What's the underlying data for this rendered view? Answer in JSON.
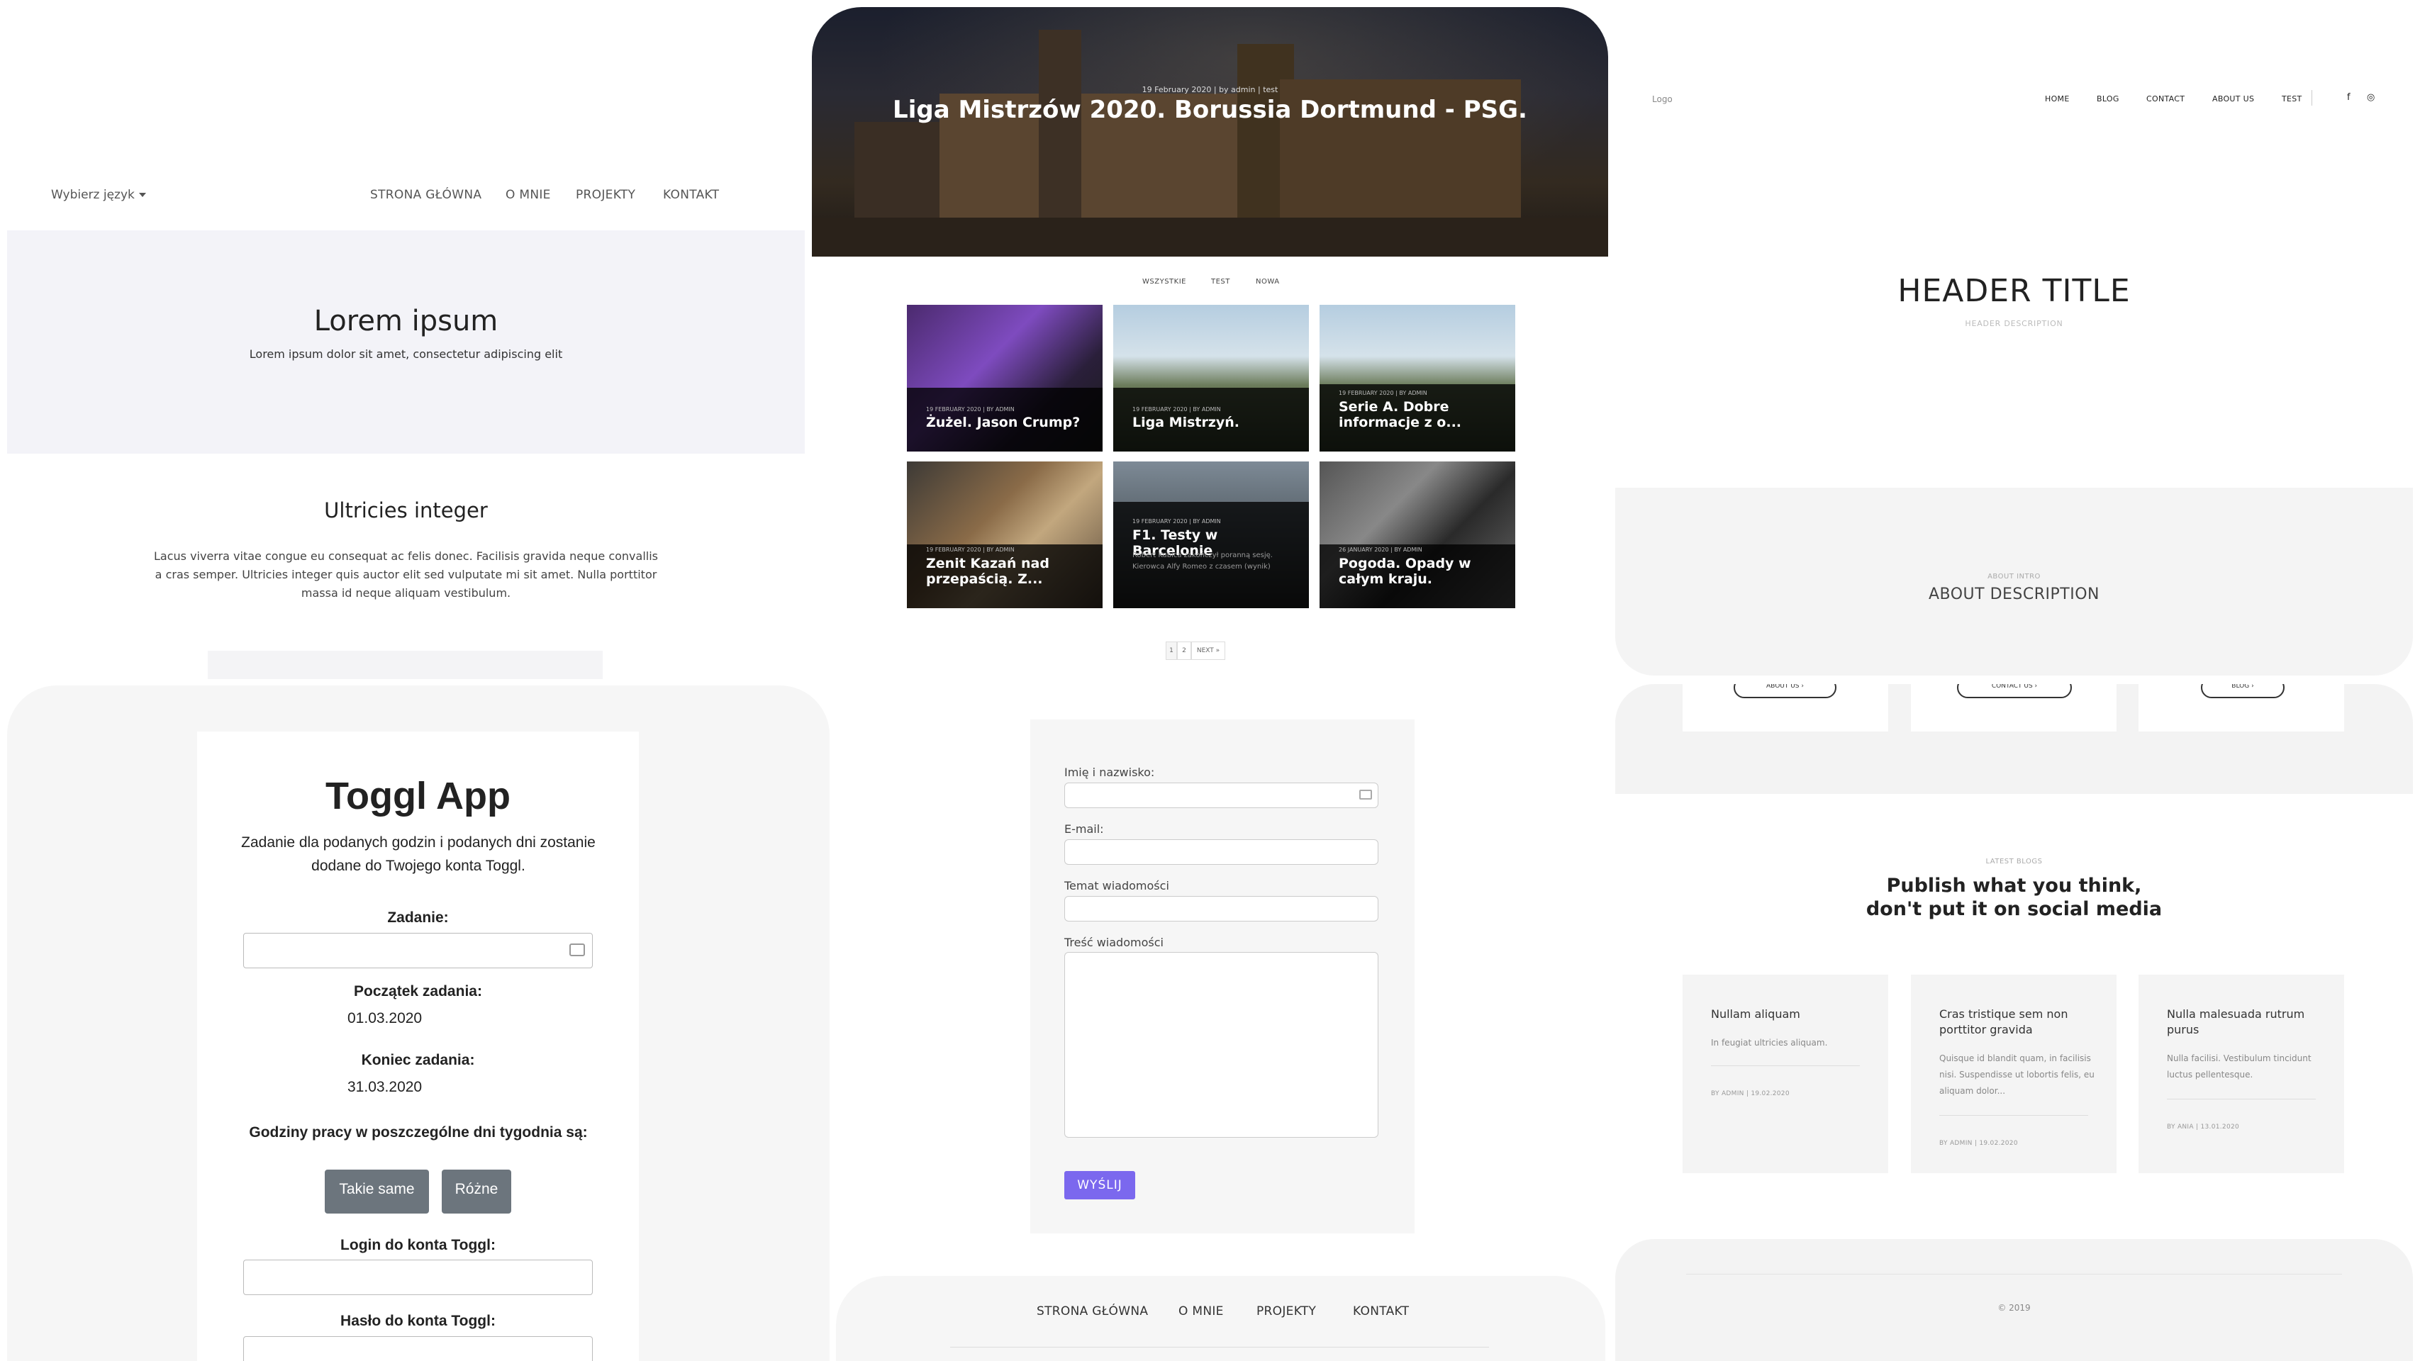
{
  "p1": {
    "language_select": "Wybierz język",
    "nav": [
      "STRONA GŁÓWNA",
      "O MNIE",
      "PROJEKTY",
      "KONTAKT"
    ],
    "hero_title": "Lorem ipsum",
    "hero_subtitle": "Lorem ipsum dolor sit amet, consectetur adipiscing elit",
    "section_title": "Ultricies integer",
    "section_text": "Lacus viverra vitae congue eu consequat ac felis donec. Facilisis gravida neque convallis a cras semper. Ultricies integer quis auctor elit sed vulputate mi sit amet. Nulla porttitor massa id neque aliquam vestibulum."
  },
  "p2": {
    "hero_meta": "19 February 2020 | by admin | test",
    "hero_title": "Liga Mistrzów 2020. Borussia Dortmund - PSG.",
    "filters": [
      "WSZYSTKIE",
      "TEST",
      "NOWA"
    ],
    "cards": [
      {
        "meta": "19 FEBRUARY 2020 | BY ADMIN",
        "title": "Żużel. Jason Crump?",
        "excerpt": ""
      },
      {
        "meta": "19 FEBRUARY 2020 | BY ADMIN",
        "title": "Liga Mistrzyń.",
        "excerpt": ""
      },
      {
        "meta": "19 FEBRUARY 2020 | BY ADMIN",
        "title": "Serie A. Dobre informacje z o...",
        "excerpt": ""
      },
      {
        "meta": "19 FEBRUARY 2020 | BY ADMIN",
        "title": "Zenit Kazań nad przepaścią. Z...",
        "excerpt": ""
      },
      {
        "meta": "19 FEBRUARY 2020 | BY ADMIN",
        "title": "F1. Testy w Barcelonie",
        "excerpt": "Robert Kubica zakończył poranną sesję. Kierowca Alfy Romeo z czasem (wynik)"
      },
      {
        "meta": "26 JANUARY 2020 | BY ADMIN",
        "title": "Pogoda. Opady w całym kraju.",
        "excerpt": ""
      }
    ],
    "pager": [
      "1",
      "2",
      "NEXT »"
    ]
  },
  "p3": {
    "logo": "Logo",
    "nav": [
      "HOME",
      "BLOG",
      "CONTACT",
      "ABOUT US",
      "TEST"
    ],
    "social": [
      "f",
      "◎"
    ],
    "header_title": "HEADER TITLE",
    "header_desc": "HEADER DESCRIPTION",
    "about_intro": "ABOUT INTRO",
    "about_desc": "ABOUT DESCRIPTION"
  },
  "p4": {
    "title": "Toggl App",
    "desc": "Zadanie dla podanych godzin i podanych dni zostanie dodane do Twojego konta Toggl.",
    "task_label": "Zadanie:",
    "start_label": "Początek zadania:",
    "start_value": "01.03.2020",
    "end_label": "Koniec zadania:",
    "end_value": "31.03.2020",
    "hours_label": "Godziny pracy w poszczególne dni tygodnia są:",
    "btn_same": "Takie same",
    "btn_diff": "Różne",
    "login_label": "Login do konta Toggl:",
    "password_label": "Hasło do konta Toggl:"
  },
  "p5": {
    "name_label": "Imię i nazwisko:",
    "email_label": "E-mail:",
    "subject_label": "Temat wiadomości",
    "message_label": "Treść wiadomości",
    "send": "WYŚLIJ",
    "footer_nav": [
      "STRONA GŁÓWNA",
      "O MNIE",
      "PROJEKTY",
      "KONTAKT"
    ]
  },
  "p6": {
    "buttons": [
      "ABOUT US  ›",
      "CONTACT US  ›",
      "BLOG  ›"
    ],
    "latest": "LATEST BLOGS",
    "headline": "Publish what you think, don't put it on social media",
    "posts": [
      {
        "title": "Nullam aliquam",
        "excerpt": "In feugiat ultricies aliquam.",
        "meta": "BY ADMIN  |  19.02.2020"
      },
      {
        "title": "Cras tristique sem non porttitor gravida",
        "excerpt": "Quisque id blandit quam, in facilisis nisi. Suspendisse ut lobortis felis, eu aliquam dolor...",
        "meta": "BY ADMIN  |  19.02.2020"
      },
      {
        "title": "Nulla malesuada rutrum purus",
        "excerpt": "Nulla facilisi. Vestibulum tincidunt luctus pellentesque.",
        "meta": "BY ANIA  |  13.01.2020"
      }
    ],
    "copyright": "© 2019"
  },
  "colors": {
    "accent": "#7b68ee",
    "toggl_button": "#6c757d",
    "hero_bg": "#f3f3f8",
    "panel_bg": "#f4f4f4"
  }
}
